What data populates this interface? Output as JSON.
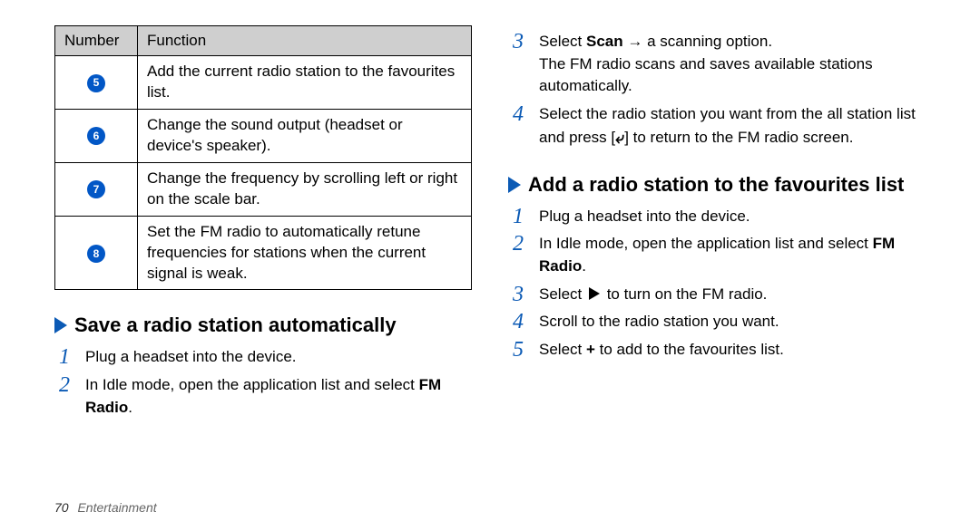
{
  "table": {
    "headers": {
      "num": "Number",
      "func": "Function"
    },
    "rows": [
      {
        "n": "5",
        "text": "Add the current radio station to the favourites list."
      },
      {
        "n": "6",
        "text": "Change the sound output (headset or device's speaker)."
      },
      {
        "n": "7",
        "text": "Change the frequency by scrolling left or right on the scale bar."
      },
      {
        "n": "8",
        "text": "Set the FM radio to automatically retune frequencies for stations when the current signal is weak."
      }
    ]
  },
  "save": {
    "heading": "Save a radio station automatically",
    "steps": {
      "s1": "Plug a headset into the device.",
      "s2a": "In Idle mode, open the application list and select ",
      "s2b": "FM Radio",
      "s2c": ".",
      "s3a": "Select ",
      "s3b": "Scan",
      "s3c": " → a scanning option.",
      "s3note": "The FM radio scans and saves available stations automatically.",
      "s4a": "Select the radio station you want from the all station list and press [",
      "s4b": "] to return to the FM radio screen."
    }
  },
  "fav": {
    "heading": "Add a radio station to the favourites list",
    "steps": {
      "s1": "Plug a headset into the device.",
      "s2a": "In Idle mode, open the application list and select ",
      "s2b": "FM Radio",
      "s2c": ".",
      "s3a": "Select ",
      "s3b": " to turn on the FM radio.",
      "s4": "Scroll to the radio station you want.",
      "s5a": "Select ",
      "s5b": "+",
      "s5c": " to add to the favourites list."
    }
  },
  "footer": {
    "page": "70",
    "title": "Entertainment"
  },
  "glyph": {
    "return": "⤶"
  }
}
